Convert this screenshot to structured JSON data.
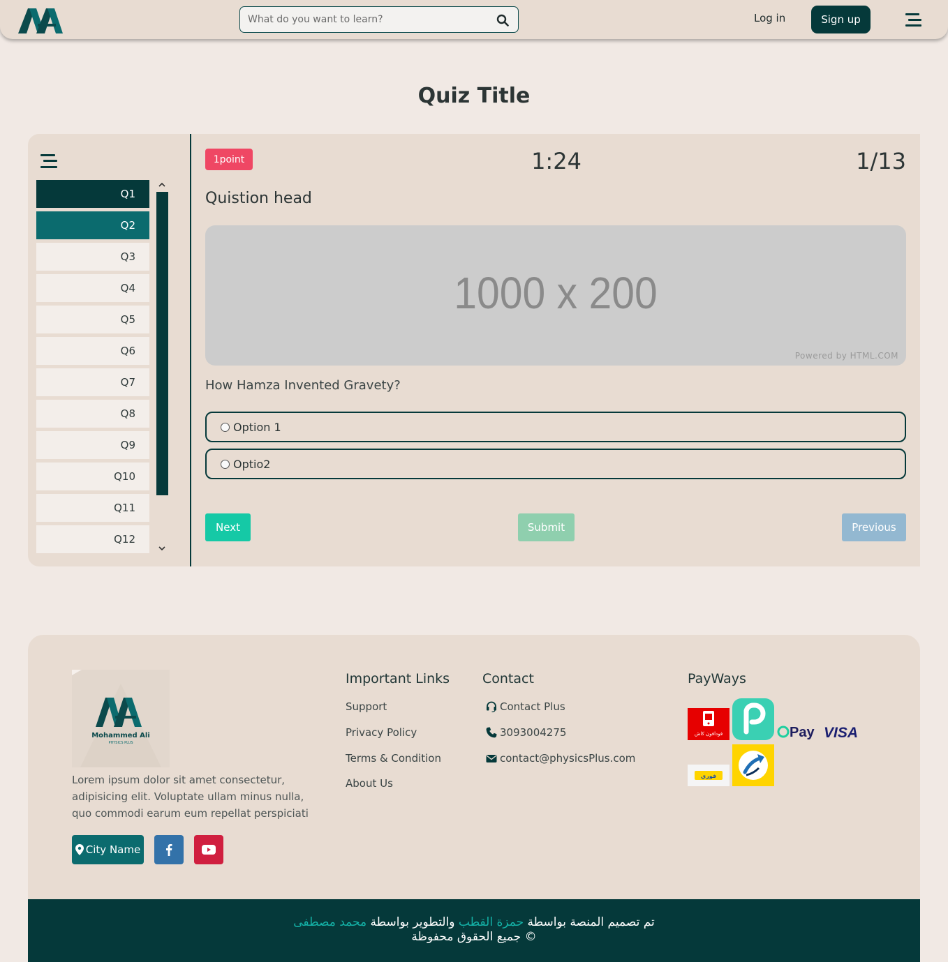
{
  "header": {
    "search_placeholder": "What do you want to learn?",
    "login_label": "Log in",
    "signup_label": "Sign up"
  },
  "quiz": {
    "title": "Quiz Title",
    "questions": [
      "Q1",
      "Q2",
      "Q3",
      "Q4",
      "Q5",
      "Q6",
      "Q7",
      "Q8",
      "Q9",
      "Q10",
      "Q11",
      "Q12"
    ],
    "points": "1point",
    "timer": "1:24",
    "counter": "1/13",
    "question_head": "Quistion head",
    "image_text": "1000 x 200",
    "image_credit": "Powered by HTML.COM",
    "question_text": "How Hamza Invented Gravety?",
    "options": [
      "Option 1",
      "Optio2"
    ],
    "next_label": "Next",
    "submit_label": "Submit",
    "previous_label": "Previous"
  },
  "footer": {
    "logo_name": "Mohammed Ali",
    "logo_sub": "PHYSICS PLUS",
    "description": "Lorem ipsum dolor sit amet consectetur, adipisicing elit. Voluptate ullam minus nulla, quo commodi earum eum repellat perspiciati",
    "city_label": "City Name",
    "links_heading": "Important Links",
    "links": [
      "Support",
      "Privacy Policy",
      "Terms & Condition",
      "About Us"
    ],
    "contact_heading": "Contact",
    "contact_plus": "Contact Plus",
    "phone": "3093004275",
    "email": "contact@physicsPlus.com",
    "payways_heading": "PayWays",
    "pay": {
      "vodafone_text": "فودافون كاش",
      "opay_text": "Pay",
      "visa_text": "VISA",
      "fawry_text": "فوري"
    },
    "credit_part1": "تم تصميم المنصة بواسطة",
    "credit_name1": "حمزة القطب",
    "credit_part2": "والتطوير بواسطة",
    "credit_name2": "محمد مصطفى",
    "rights": "© جميع الحقوق محفوظة"
  },
  "colors": {
    "primary_dark": "#05393a",
    "primary": "#0b6b6e",
    "background": "#f1e9e4",
    "panel": "#e8dcd2",
    "points_badge": "#ef4764",
    "next": "#15c9a6",
    "submit": "#8fcfae",
    "previous": "#93b8d1"
  }
}
